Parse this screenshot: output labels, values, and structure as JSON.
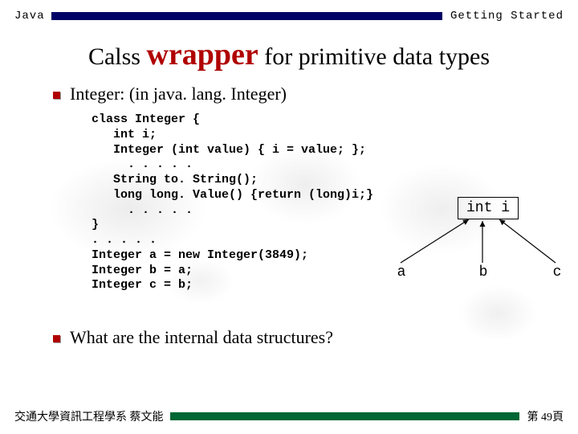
{
  "header": {
    "left": "Java",
    "right": "Getting Started"
  },
  "title": {
    "pre": "Calss ",
    "emph": "wrapper",
    "post": " for primitive data types"
  },
  "bullet1": "Integer: (in java. lang. Integer)",
  "code": "class Integer {\n   int i;\n   Integer (int value) { i = value; };\n     . . . . .\n   String to. String();\n   long long. Value() {return (long)i;}\n     . . . . .\n}\n. . . . .\nInteger a = new Integer(3849);\nInteger b = a;\nInteger c = b;",
  "diagram": {
    "box": "int i",
    "a": "a",
    "b": "b",
    "c": "c"
  },
  "question": "What are the internal data structures?",
  "footer": {
    "left": "交通大學資訊工程學系 蔡文能",
    "right": "第 49頁"
  }
}
